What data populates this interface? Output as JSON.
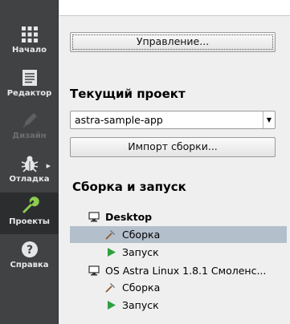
{
  "modes": [
    {
      "label": "Начало",
      "icon": "grid-icon"
    },
    {
      "label": "Редактор",
      "icon": "document-icon"
    },
    {
      "label": "Дизайн",
      "icon": "pencil-icon"
    },
    {
      "label": "Отладка",
      "icon": "bug-icon"
    },
    {
      "label": "Проекты",
      "icon": "wrench-icon"
    },
    {
      "label": "Справка",
      "icon": "help-icon"
    }
  ],
  "main": {
    "manage_button": "Управление...",
    "current_project_heading": "Текущий проект",
    "project_combo_value": "astra-sample-app",
    "import_button": "Импорт сборки...",
    "build_run_heading": "Сборка и запуск",
    "kits": [
      {
        "name": "Desktop",
        "build": "Сборка",
        "run": "Запуск"
      },
      {
        "name": "OS Astra Linux 1.8.1 Смоленс...",
        "build": "Сборка",
        "run": "Запуск"
      }
    ]
  },
  "colors": {
    "modebar_bg": "#404244",
    "selection": "#b4bfcc",
    "run_green": "#2ea042",
    "wrench_green": "#8ccc50"
  }
}
